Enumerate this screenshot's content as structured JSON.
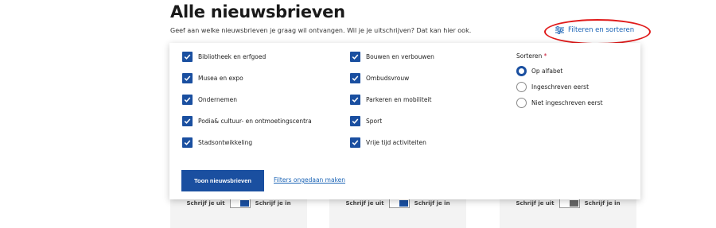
{
  "page": {
    "title": "Alle nieuwsbrieven",
    "subtitle": "Geef aan welke nieuwsbrieven je graag wil ontvangen. Wil je je uitschrijven? Dat kan hier ook."
  },
  "filter_link": {
    "label": "Filteren en sorteren",
    "icon": "sliders-icon"
  },
  "categories_col1": [
    {
      "label": "Bibliotheek en erfgoed",
      "checked": true
    },
    {
      "label": "Musea en expo",
      "checked": true
    },
    {
      "label": "Ondernemen",
      "checked": true
    },
    {
      "label": "Podia& cultuur- en ontmoetingscentra",
      "checked": true
    },
    {
      "label": "Stadsontwikkeling",
      "checked": true
    }
  ],
  "categories_col2": [
    {
      "label": "Bouwen en verbouwen",
      "checked": true
    },
    {
      "label": "Ombudsvrouw",
      "checked": true
    },
    {
      "label": "Parkeren en mobiliteit",
      "checked": true
    },
    {
      "label": "Sport",
      "checked": true
    },
    {
      "label": "Vrije tijd activiteiten",
      "checked": true
    }
  ],
  "sort": {
    "label": "Sorteren",
    "required_marker": "*",
    "options": [
      {
        "label": "Op alfabet",
        "selected": true
      },
      {
        "label": "Ingeschreven eerst",
        "selected": false
      },
      {
        "label": "Niet ingeschreven eerst",
        "selected": false
      }
    ]
  },
  "actions": {
    "primary": "Toon nieuwsbrieven",
    "reset": "Filters ongedaan maken"
  },
  "background_cards": [
    {
      "left_text": "Schrijf je uit",
      "right_text": "Schrijf je in"
    },
    {
      "left_text": "Schrijf je uit",
      "right_text": "Schrijf je in"
    },
    {
      "left_text": "Schrijf je uit",
      "right_text": "Schrijf je in"
    }
  ],
  "colors": {
    "accent": "#1a4fa0",
    "link": "#1a63b5",
    "annotation": "#e01a1a"
  }
}
